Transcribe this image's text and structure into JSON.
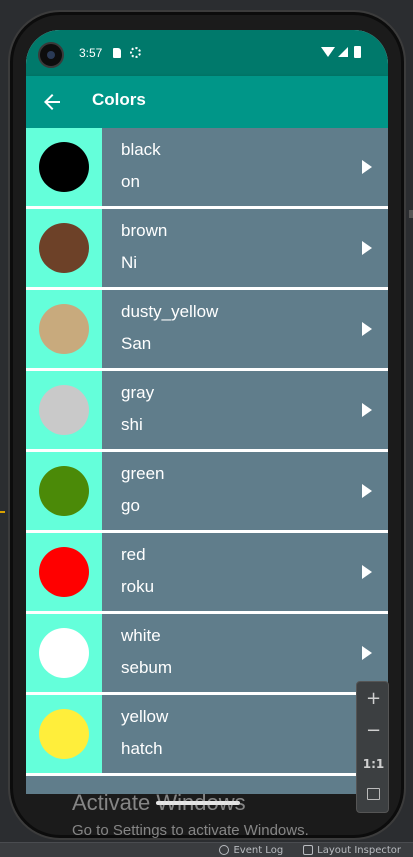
{
  "status": {
    "time": "3:57"
  },
  "appbar": {
    "title": "Colors"
  },
  "colors": [
    {
      "name": "black",
      "sub": "on",
      "hex": "#000000"
    },
    {
      "name": "brown",
      "sub": "Ni",
      "hex": "#6d4128"
    },
    {
      "name": "dusty_yellow",
      "sub": "San",
      "hex": "#c8aa7d"
    },
    {
      "name": "gray",
      "sub": "shi",
      "hex": "#c9c9c9"
    },
    {
      "name": "green",
      "sub": "go",
      "hex": "#4b8a08"
    },
    {
      "name": "red",
      "sub": "roku",
      "hex": "#ff0000"
    },
    {
      "name": "white",
      "sub": "sebum",
      "hex": "#ffffff"
    },
    {
      "name": "yellow",
      "sub": "hatch",
      "hex": "#ffee3b"
    }
  ],
  "theme": {
    "statusbar": "#00796b",
    "appbar": "#009688",
    "row_background": "#607d8b",
    "swatch_background": "#64ffda"
  },
  "zoom_panel": {
    "zoom_in": "+",
    "zoom_out": "−",
    "actual_size": "1:1",
    "fit_icon": "fit-screen-icon"
  },
  "watermark": {
    "line1": "Activate Windows",
    "line2": "Go to Settings to activate Windows."
  },
  "ide": {
    "event_log": "Event Log",
    "layout_inspector": "Layout Inspector"
  }
}
